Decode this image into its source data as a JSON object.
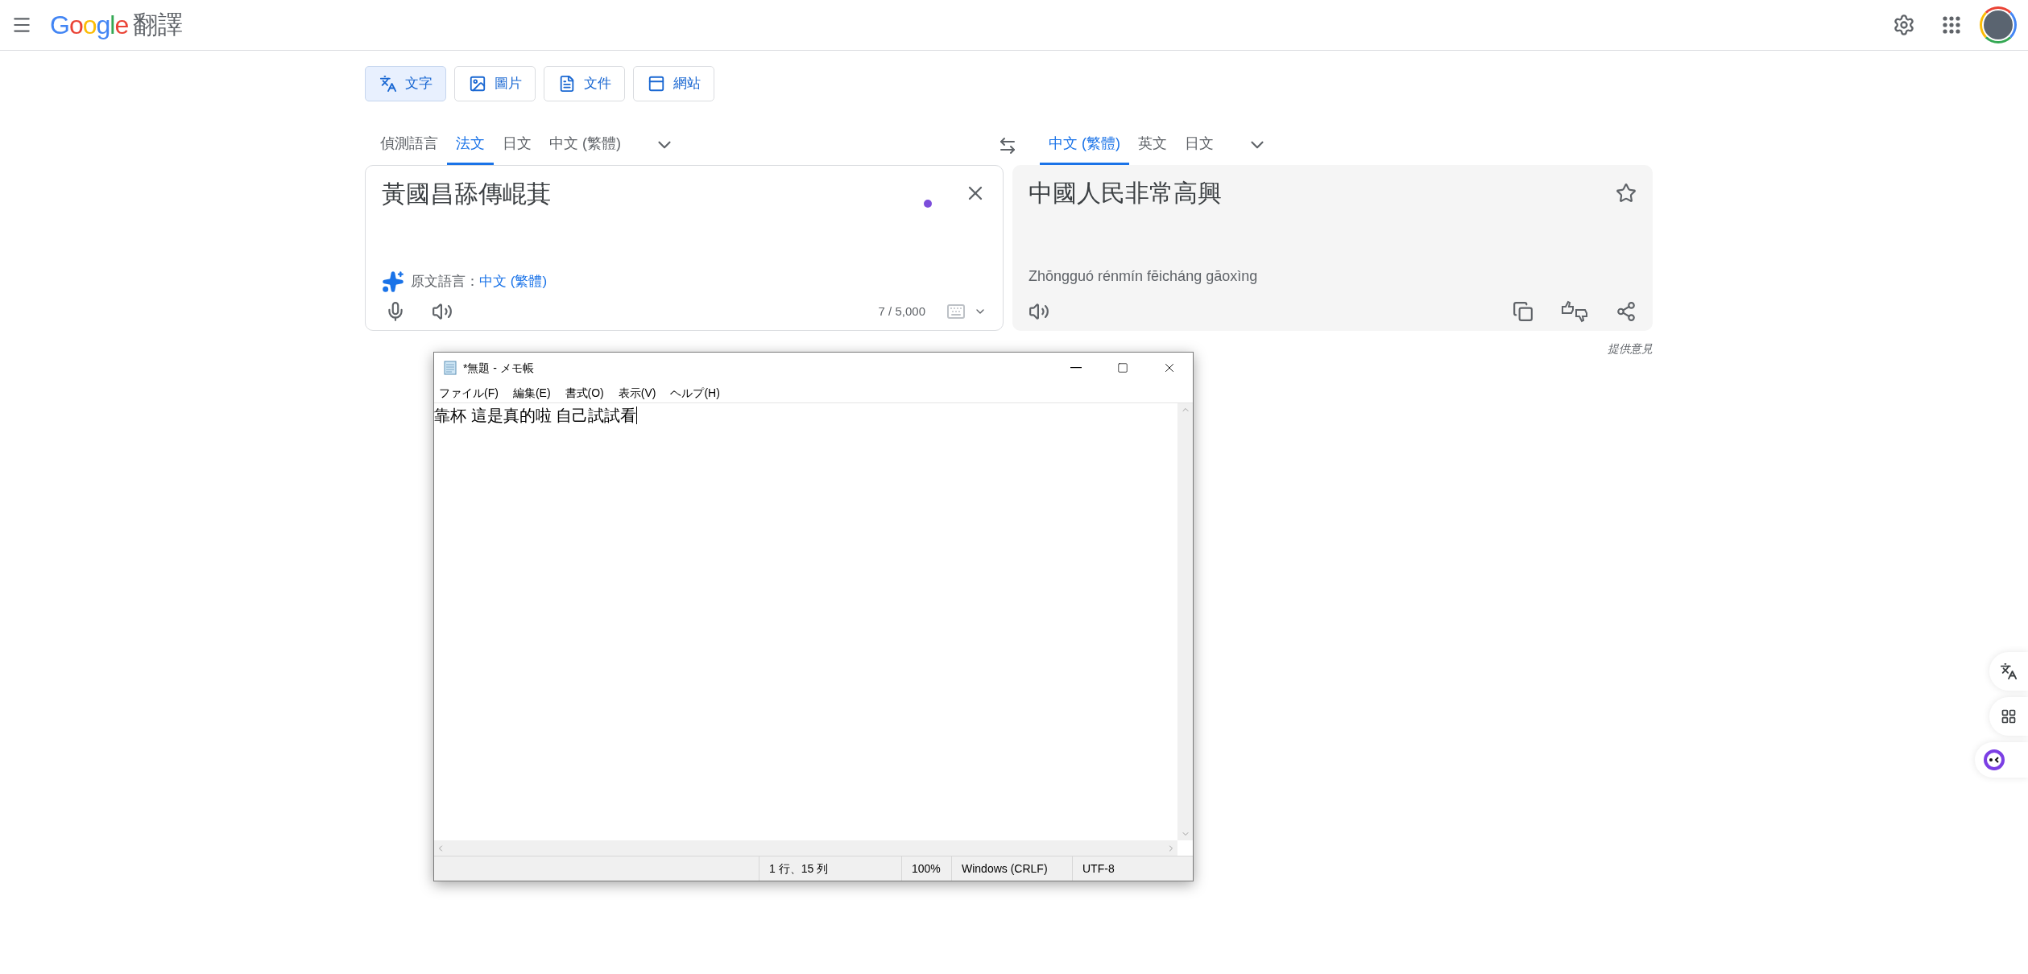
{
  "header": {
    "logo": "Google",
    "product": "翻譯"
  },
  "modes": [
    {
      "kind": "text",
      "label": "文字",
      "selected": true
    },
    {
      "kind": "image",
      "label": "圖片",
      "selected": false
    },
    {
      "kind": "document",
      "label": "文件",
      "selected": false
    },
    {
      "kind": "website",
      "label": "網站",
      "selected": false
    }
  ],
  "source_languages": [
    {
      "label": "偵測語言",
      "selected": false
    },
    {
      "label": "法文",
      "selected": true
    },
    {
      "label": "日文",
      "selected": false
    },
    {
      "label": "中文 (繁體)",
      "selected": false
    }
  ],
  "target_languages": [
    {
      "label": "中文 (繁體)",
      "selected": true
    },
    {
      "label": "英文",
      "selected": false
    },
    {
      "label": "日文",
      "selected": false
    }
  ],
  "source": {
    "text": "黃國昌舔傳崐萁",
    "detected_prefix": "原文語言：",
    "detected_language": "中文 (繁體)",
    "char_count": "7 / 5,000"
  },
  "target": {
    "text": "中國人民非常高興",
    "romanization": "Zhōngguó rénmín fēicháng gāoxìng"
  },
  "feedback": "提供意見",
  "notepad": {
    "title": "*無題 - メモ帳",
    "menu": [
      "ファイル(F)",
      "編集(E)",
      "書式(O)",
      "表示(V)",
      "ヘルプ(H)"
    ],
    "content": "靠杯 這是真的啦 自己試試看",
    "status": [
      "1 行、15 列",
      "100%",
      "Windows (CRLF)",
      "UTF-8"
    ]
  }
}
